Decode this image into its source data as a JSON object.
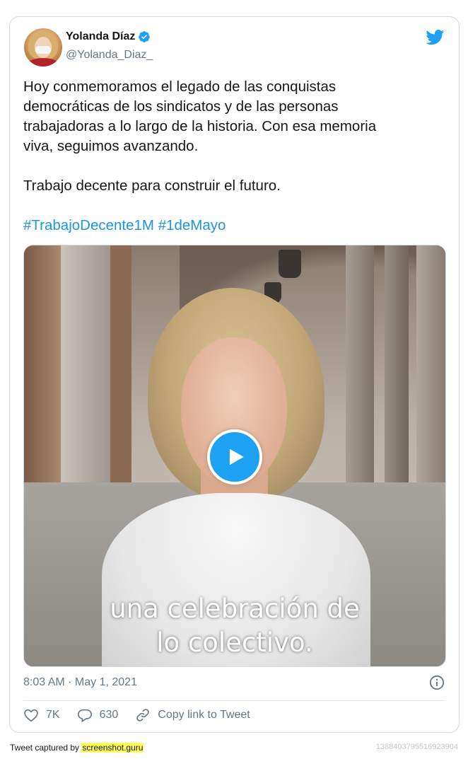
{
  "tweet": {
    "author": {
      "display_name": "Yolanda Díaz",
      "handle": "@Yolanda_Diaz_",
      "verified": true
    },
    "text": {
      "line1": "Hoy conmemoramos el legado de las conquistas",
      "line2": "democráticas de los sindicatos y de las personas",
      "line3": "trabajadoras a lo largo de la historia. Con esa memoria",
      "line4": "viva, seguimos avanzando.",
      "line5": "Trabajo decente para construir el futuro.",
      "hashtag1": "#TrabajoDecente1M",
      "hashtag2": "#1deMayo"
    },
    "media": {
      "type": "video",
      "caption_line1": "una celebración de",
      "caption_line2": "lo colectivo."
    },
    "timestamp": "8:03 AM · May 1, 2021",
    "actions": {
      "likes": "7K",
      "replies": "630",
      "copy_link": "Copy link to Tweet"
    }
  },
  "footer": {
    "captured_prefix": "Tweet captured by ",
    "captured_brand": "screenshot.guru",
    "tweet_id": "1388403795516923904"
  },
  "colors": {
    "accent": "#1da1f2",
    "hashtag": "#1b95e0",
    "secondary_text": "#657786",
    "border": "#cfd9de"
  },
  "icons": [
    "verified-badge-icon",
    "twitter-bird-icon",
    "play-icon",
    "info-icon",
    "heart-icon",
    "reply-icon",
    "link-icon"
  ]
}
